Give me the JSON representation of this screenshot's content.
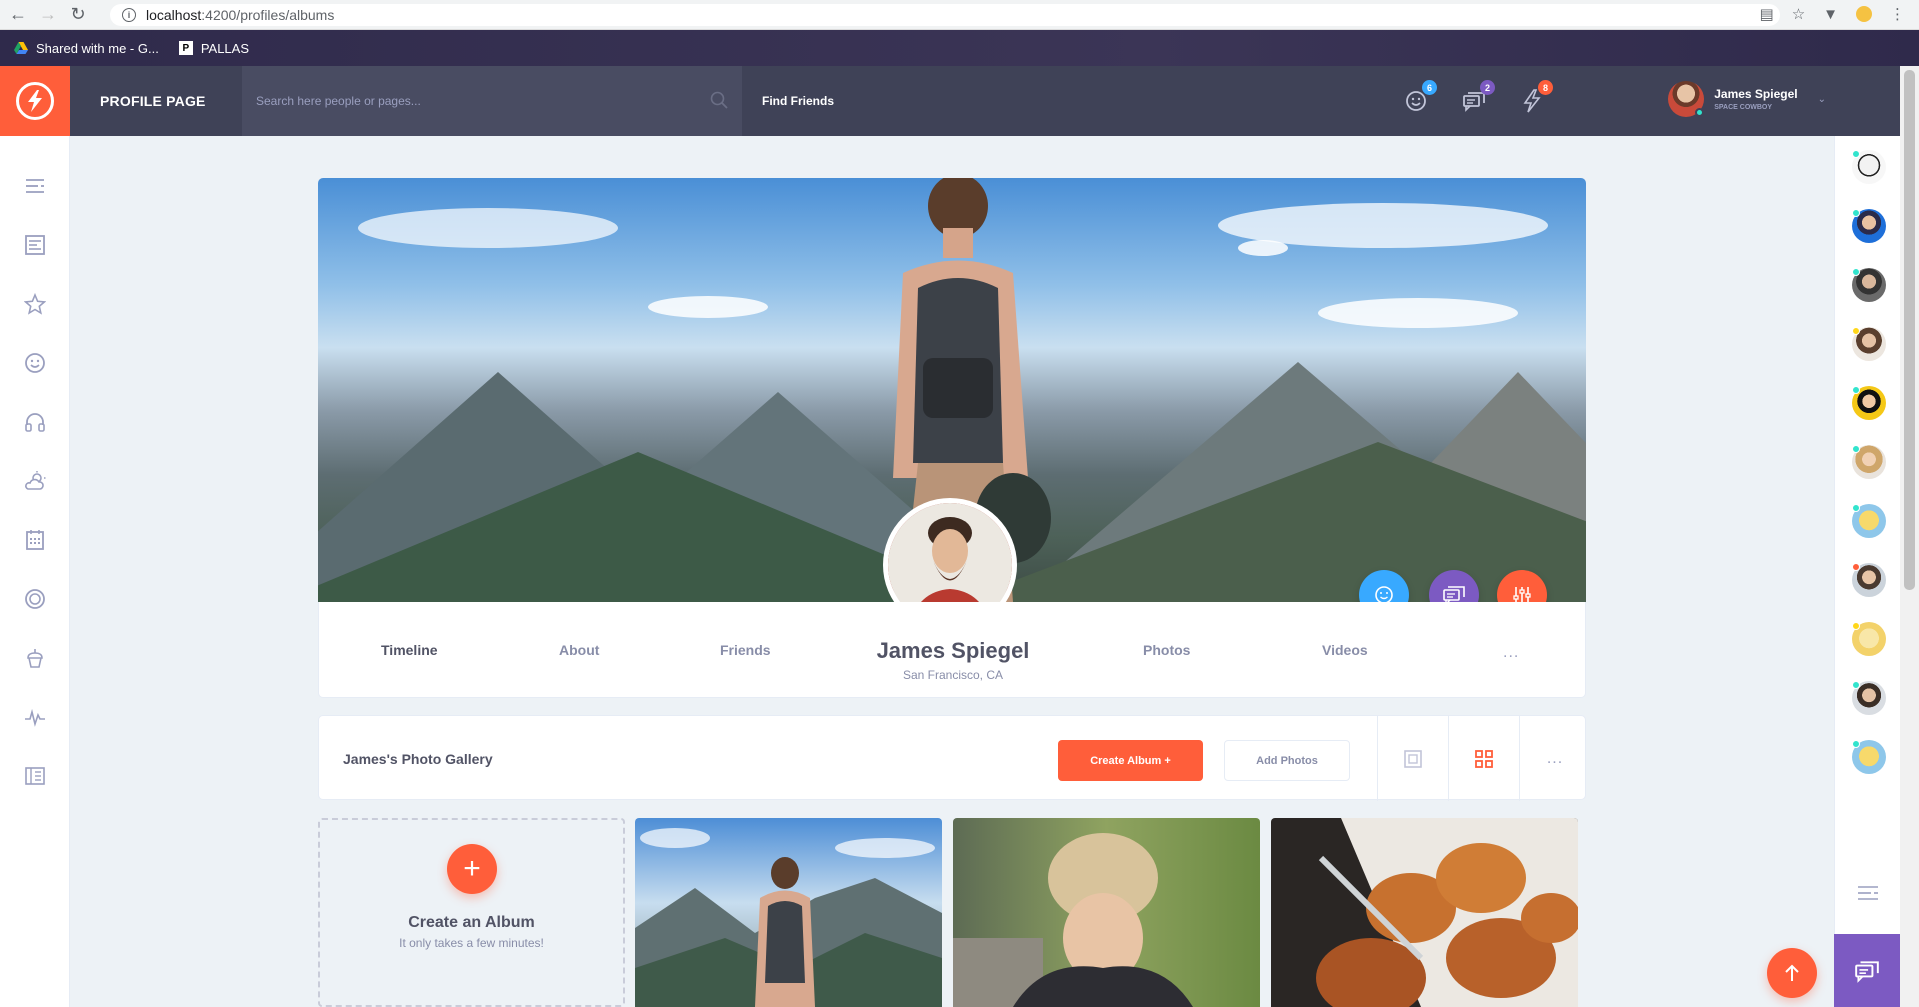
{
  "browser": {
    "url_host": "localhost",
    "url_path": ":4200/profiles/albums",
    "bookmarks": [
      {
        "label": "Shared with me - G..."
      },
      {
        "label": "PALLAS"
      }
    ]
  },
  "header": {
    "page_title": "PROFILE PAGE",
    "search_placeholder": "Search here people or pages...",
    "find_friends": "Find Friends",
    "badges": {
      "friend_requests": "6",
      "messages": "2",
      "notifications": "8"
    },
    "badge_colors": {
      "friend_requests": "#38a9ff",
      "messages": "#7c5ac2",
      "notifications": "#ff5e3a"
    },
    "user": {
      "name": "James Spiegel",
      "subtitle": "SPACE COWBOY"
    }
  },
  "profile": {
    "tabs": [
      "Timeline",
      "About",
      "Friends",
      "Photos",
      "Videos"
    ],
    "active_tab": "Timeline",
    "name": "James Spiegel",
    "location": "San Francisco, CA",
    "more": "..."
  },
  "gallery": {
    "title": "James's Photo Gallery",
    "create_album": "Create Album +",
    "add_photos": "Add Photos",
    "more": "..."
  },
  "album_new": {
    "title": "Create an Album",
    "subtitle": "It only takes a few minutes!"
  },
  "colors": {
    "accent": "#ff5e3a",
    "primary_blue": "#38a9ff",
    "purple": "#7c5ac2",
    "header_dark": "#3f4257",
    "online": "#32e4cd"
  },
  "icons": {
    "left_sidebar": [
      "menu-lines-icon",
      "newsfeed-icon",
      "star-icon",
      "happy-face-icon",
      "headphones-icon",
      "weather-icon",
      "calendar-icon",
      "badge-icon",
      "cupcake-icon",
      "stats-icon",
      "manage-widgets-icon"
    ],
    "header": [
      "friend-request-icon",
      "chat-messages-icon",
      "thunder-icon"
    ],
    "actions": [
      "happy-face-icon",
      "chat-messages-icon",
      "settings-sliders-icon"
    ]
  }
}
